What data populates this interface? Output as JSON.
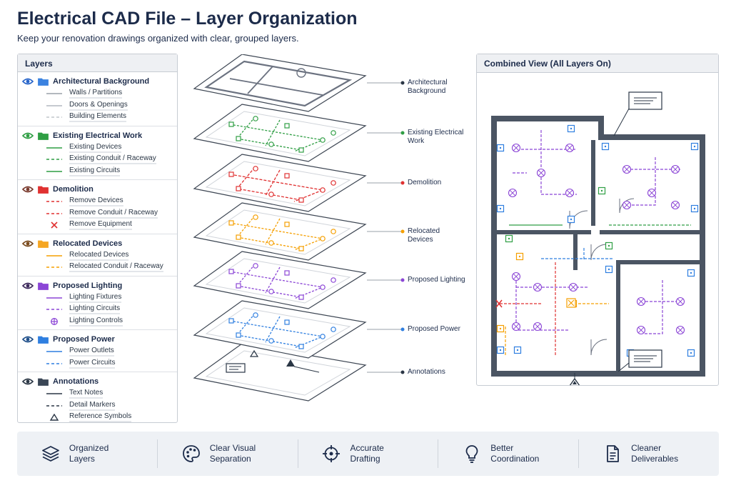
{
  "header": {
    "title": "Electrical CAD File – Layer Organization",
    "subtitle": "Keep your renovation drawings organized with clear, grouped layers."
  },
  "layers_panel": {
    "title": "Layers",
    "groups": [
      {
        "name": "Architectural Background",
        "color": "#3b82e0",
        "eye_color": "#2563c9",
        "items": [
          {
            "label": "Walls / Partitions",
            "style": "solid",
            "color": "#9aa0a8"
          },
          {
            "label": "Doors & Openings",
            "style": "solid",
            "color": "#b4b9c0"
          },
          {
            "label": "Building Elements",
            "style": "dashed",
            "color": "#c1c5cb"
          }
        ]
      },
      {
        "name": "Existing Electrical Work",
        "color": "#2f9e44",
        "eye_color": "#2f9e44",
        "items": [
          {
            "label": "Existing Devices",
            "style": "solid",
            "color": "#2f9e44"
          },
          {
            "label": "Existing Conduit / Raceway",
            "style": "dashed",
            "color": "#2f9e44"
          },
          {
            "label": "Existing Circuits",
            "style": "solid",
            "color": "#2f9e44"
          }
        ]
      },
      {
        "name": "Demolition",
        "color": "#e03131",
        "eye_color": "#7a3b2e",
        "items": [
          {
            "label": "Remove Devices",
            "style": "dashed",
            "color": "#e03131"
          },
          {
            "label": "Remove Conduit / Raceway",
            "style": "dashed",
            "color": "#e03131"
          },
          {
            "label": "Remove Equipment",
            "style": "x",
            "color": "#e03131"
          }
        ]
      },
      {
        "name": "Relocated Devices",
        "color": "#f5a623",
        "eye_color": "#7a4b1e",
        "items": [
          {
            "label": "Relocated Devices",
            "style": "solid",
            "color": "#f59f00"
          },
          {
            "label": "Relocated Conduit / Raceway",
            "style": "dashed",
            "color": "#f59f00"
          }
        ]
      },
      {
        "name": "Proposed Lighting",
        "color": "#8b45d6",
        "eye_color": "#3d2a5c",
        "items": [
          {
            "label": "Lighting Fixtures",
            "style": "solid",
            "color": "#8b45d6"
          },
          {
            "label": "Lighting Circuits",
            "style": "dashed",
            "color": "#8b45d6"
          },
          {
            "label": "Lighting Controls",
            "style": "crosscircle",
            "color": "#8b45d6"
          }
        ]
      },
      {
        "name": "Proposed Power",
        "color": "#2f7fe0",
        "eye_color": "#1f4f8a",
        "items": [
          {
            "label": "Power Outlets",
            "style": "solid",
            "color": "#2f7fe0"
          },
          {
            "label": "Power Circuits",
            "style": "dashed",
            "color": "#2f7fe0"
          }
        ]
      },
      {
        "name": "Annotations",
        "color": "#3a4656",
        "eye_color": "#2a3645",
        "items": [
          {
            "label": "Text Notes",
            "style": "solid",
            "color": "#2a3645"
          },
          {
            "label": "Detail Markers",
            "style": "dashed",
            "color": "#2a3645"
          },
          {
            "label": "Reference Symbols",
            "style": "triangle",
            "color": "#2a3645"
          }
        ]
      }
    ]
  },
  "stack": {
    "layers": [
      {
        "label": "Architectural Background",
        "color": "#9aa0a8"
      },
      {
        "label": "Existing Electrical Work",
        "color": "#2f9e44"
      },
      {
        "label": "Demolition",
        "color": "#e03131"
      },
      {
        "label": "Relocated Devices",
        "color": "#f59f00"
      },
      {
        "label": "Proposed Lighting",
        "color": "#8b45d6"
      },
      {
        "label": "Proposed Power",
        "color": "#2f7fe0"
      },
      {
        "label": "Annotations",
        "color": "#2a3645"
      }
    ]
  },
  "combined_view": {
    "title": "Combined View (All Layers On)"
  },
  "benefits": [
    {
      "label": "Organized Layers",
      "icon": "layers-icon"
    },
    {
      "label": "Clear Visual Separation",
      "icon": "palette-icon"
    },
    {
      "label": "Accurate Drafting",
      "icon": "crosshair-icon"
    },
    {
      "label": "Better Coordination",
      "icon": "lightbulb-icon"
    },
    {
      "label": "Cleaner Deliverables",
      "icon": "document-icon"
    }
  ]
}
